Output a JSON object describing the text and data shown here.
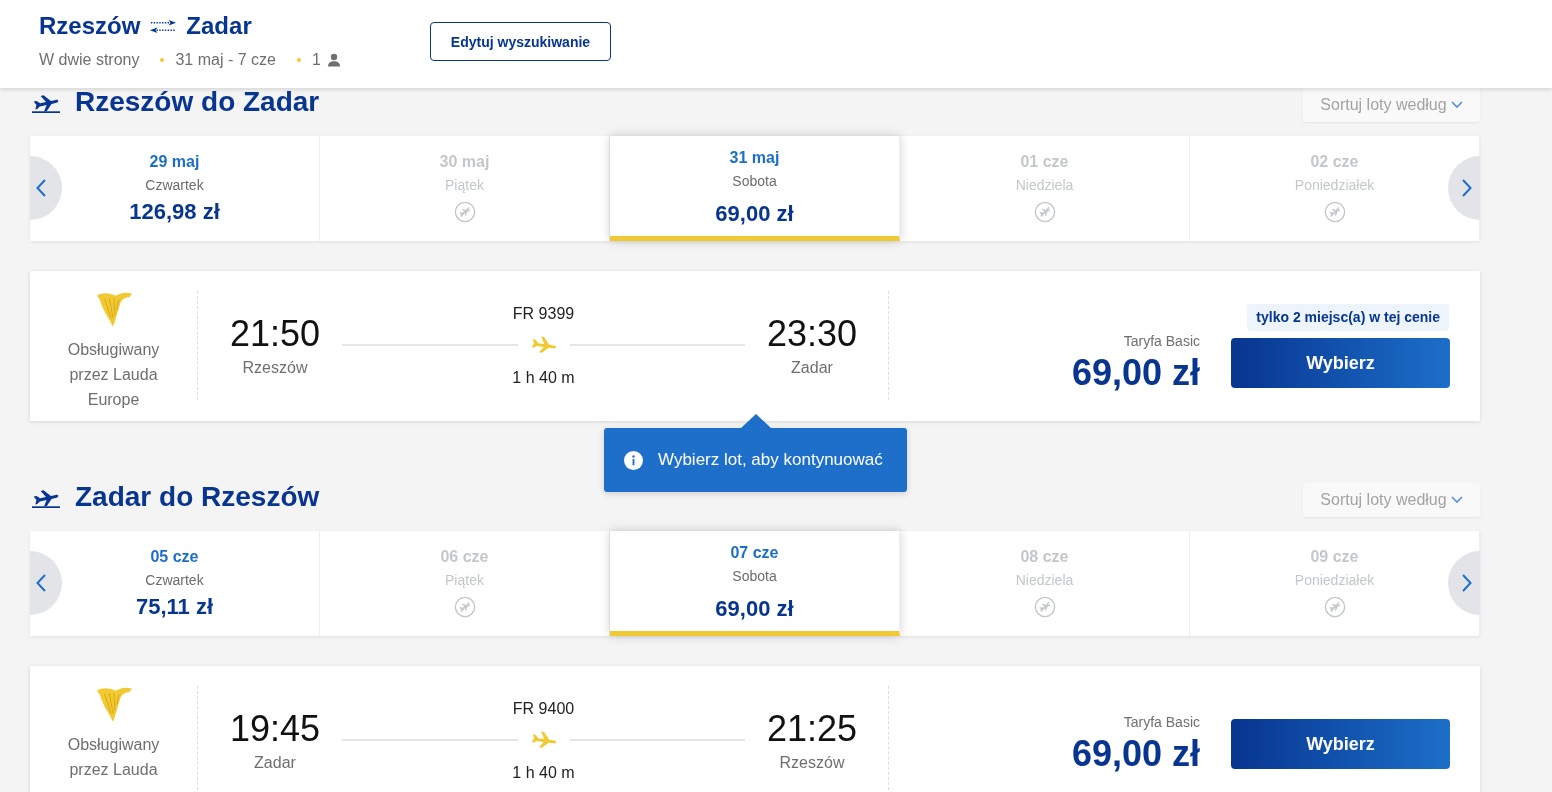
{
  "header": {
    "origin": "Rzeszów",
    "destination": "Zadar",
    "trip_type": "W dwie strony",
    "dates": "31 maj - 7 cze",
    "passengers": "1",
    "edit_button": "Edytuj wyszukiwanie"
  },
  "legs": [
    {
      "title": "Rzeszów do Zadar",
      "sort_label": "Sortuj loty według",
      "days": [
        {
          "date": "29 maj",
          "weekday": "Czwartek",
          "price": "126,98 zł",
          "available": true,
          "selected": false
        },
        {
          "date": "30 maj",
          "weekday": "Piątek",
          "available": false,
          "selected": false
        },
        {
          "date": "31 maj",
          "weekday": "Sobota",
          "price": "69,00 zł",
          "available": true,
          "selected": true
        },
        {
          "date": "01 cze",
          "weekday": "Niedziela",
          "available": false,
          "selected": false
        },
        {
          "date": "02 cze",
          "weekday": "Poniedziałek",
          "available": false,
          "selected": false
        }
      ],
      "flight": {
        "operator": "Obsługiwany przez Lauda Europe",
        "departure_time": "21:50",
        "departure_city": "Rzeszów",
        "flight_number": "FR 9399",
        "duration": "1 h 40 m",
        "arrival_time": "23:30",
        "arrival_city": "Zadar",
        "fare": "Taryfa Basic",
        "price": "69,00 zł",
        "seats_notice": "tylko 2 miejsc(a) w tej cenie",
        "select_button": "Wybierz",
        "tooltip": "Wybierz lot, aby kontynuować"
      }
    },
    {
      "title": "Zadar do Rzeszów",
      "sort_label": "Sortuj loty według",
      "days": [
        {
          "date": "05 cze",
          "weekday": "Czwartek",
          "price": "75,11 zł",
          "available": true,
          "selected": false
        },
        {
          "date": "06 cze",
          "weekday": "Piątek",
          "available": false,
          "selected": false
        },
        {
          "date": "07 cze",
          "weekday": "Sobota",
          "price": "69,00 zł",
          "available": true,
          "selected": true
        },
        {
          "date": "08 cze",
          "weekday": "Niedziela",
          "available": false,
          "selected": false
        },
        {
          "date": "09 cze",
          "weekday": "Poniedziałek",
          "available": false,
          "selected": false
        }
      ],
      "flight": {
        "operator": "Obsługiwany przez Lauda",
        "departure_time": "19:45",
        "departure_city": "Zadar",
        "flight_number": "FR 9400",
        "duration": "1 h 40 m",
        "arrival_time": "21:25",
        "arrival_city": "Rzeszów",
        "fare": "Taryfa Basic",
        "price": "69,00 zł",
        "select_button": "Wybierz"
      }
    }
  ]
}
